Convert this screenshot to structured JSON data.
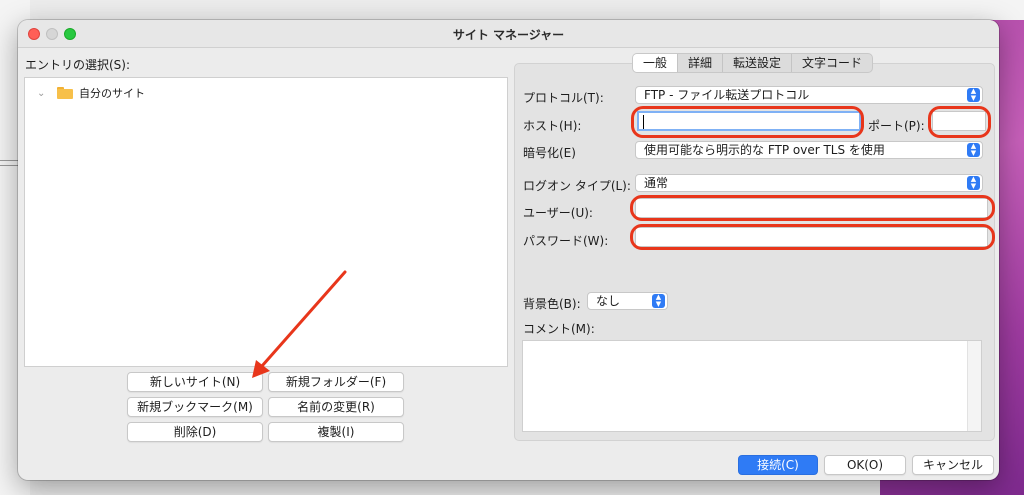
{
  "window": {
    "title": "サイト マネージャー"
  },
  "entries": {
    "label": "エントリの選択(S):",
    "items": [
      {
        "label": "自分のサイト"
      }
    ]
  },
  "left_buttons": {
    "new_site": "新しいサイト(N)",
    "new_folder": "新規フォルダー(F)",
    "new_bookmark": "新規ブックマーク(M)",
    "rename": "名前の変更(R)",
    "delete": "削除(D)",
    "duplicate": "複製(I)"
  },
  "tabs": [
    {
      "label": "一般",
      "active": true
    },
    {
      "label": "詳細",
      "active": false
    },
    {
      "label": "転送設定",
      "active": false
    },
    {
      "label": "文字コード",
      "active": false
    }
  ],
  "general": {
    "protocol": {
      "label": "プロトコル(T):",
      "value": "FTP - ファイル転送プロトコル"
    },
    "host": {
      "label": "ホスト(H):",
      "value": ""
    },
    "port": {
      "label": "ポート(P):",
      "value": ""
    },
    "encryption": {
      "label": "暗号化(E)",
      "value": "使用可能なら明示的な FTP over TLS を使用"
    },
    "logon_type": {
      "label": "ログオン タイプ(L):",
      "value": "通常"
    },
    "user": {
      "label": "ユーザー(U):",
      "value": ""
    },
    "password": {
      "label": "パスワード(W):",
      "value": ""
    },
    "background": {
      "label": "背景色(B):",
      "value": "なし"
    },
    "comment": {
      "label": "コメント(M):",
      "value": ""
    }
  },
  "footer": {
    "connect": "接続(C)",
    "ok": "OK(O)",
    "cancel": "キャンセル"
  },
  "colors": {
    "accent": "#2f7bf5",
    "annotation": "#e8361b",
    "close": "#ff5f57",
    "maximize": "#28c840"
  }
}
